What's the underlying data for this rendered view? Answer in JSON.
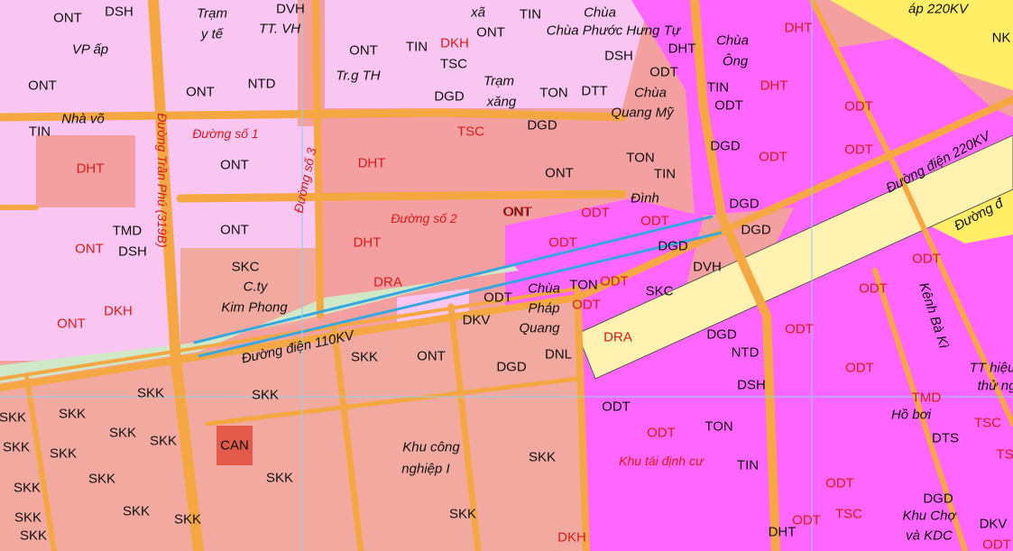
{
  "map": {
    "colors": {
      "land_residential_rural": "#f8c6f0",
      "land_public": "#f4a0a0",
      "land_industrial": "#f2aaa0",
      "land_urban": "#ff66ff",
      "road": "#f5a742",
      "power_corridor": "#fff2b0",
      "highlight_line": "#35a8e0",
      "label_red": "#d81a1a"
    },
    "road_names": {
      "tran_phu": "Đường Trần Phú (319B)",
      "duong_so_1": "Đường số 1",
      "duong_so_2": "Đường số 2",
      "duong_so_3": "Đường số 3",
      "duong_dien_110": "Đường điện 110KV",
      "duong_dien_220": "Đường điện 220KV",
      "duong_dien_220_top": "áp 220KV",
      "duong_right": "Đường đ",
      "kenh": "Kênh Bà Kì"
    },
    "places": {
      "vp_ap": "VP ấp",
      "tram_y_te_1": "Trạm",
      "tram_y_te_2": "y tế",
      "tt_vh": "TT. VH",
      "xa": "xã",
      "chua_phuoc_hung_tu": "Chùa Phước Hưng Tự",
      "chua_ong_1": "Chùa",
      "chua_ong_2": "Ông",
      "nha_vo": "Nhà võ",
      "tr_g_th": "Tr.g TH",
      "tram_xang_1": "Trạm",
      "tram_xang_2": "xăng",
      "chua_quang_my_1": "Chùa",
      "chua_quang_my_2": "Quang Mỹ",
      "dinh": "Đình",
      "ct_kim_phong_1": "C.ty",
      "ct_kim_phong_2": "Kim Phong",
      "chua_phap_quang_1": "Chùa",
      "chua_phap_quang_2": "Pháp",
      "chua_phap_quang_3": "Quang",
      "kcn_1": "Khu công",
      "kcn_2": "nghiệp I",
      "tt_hieu_1": "TT hiệu",
      "tt_hieu_2": "thử ng",
      "ho_boi": "Hồ bơi",
      "khu_tai_dinh_cu": "Khu tái định cư",
      "khu_cho_1": "Khu Chợ",
      "khu_cho_2": "và KDC"
    },
    "codes": [
      {
        "id": "c1",
        "text": "ONT",
        "red": false
      },
      {
        "id": "c2",
        "text": "DSH",
        "red": false
      },
      {
        "id": "c3",
        "text": "DVH",
        "red": false
      },
      {
        "id": "c4",
        "text": "TIN",
        "red": false
      },
      {
        "id": "c5",
        "text": "DHT",
        "red": true
      },
      {
        "id": "c6",
        "text": "ONT",
        "red": false
      },
      {
        "id": "c7",
        "text": "TIN",
        "red": false
      },
      {
        "id": "c8",
        "text": "DKH",
        "red": true
      },
      {
        "id": "c9",
        "text": "TSC",
        "red": false
      },
      {
        "id": "c10",
        "text": "ONT",
        "red": false
      },
      {
        "id": "c11",
        "text": "DHT",
        "red": false
      },
      {
        "id": "c12",
        "text": "ODT",
        "red": false
      },
      {
        "id": "c13",
        "text": "NK",
        "red": false
      },
      {
        "id": "c14",
        "text": "ONT",
        "red": false
      },
      {
        "id": "c15",
        "text": "ONT",
        "red": false
      },
      {
        "id": "c16",
        "text": "NTD",
        "red": false
      },
      {
        "id": "c17",
        "text": "DGD",
        "red": false
      },
      {
        "id": "c18",
        "text": "TON",
        "red": false
      },
      {
        "id": "c19",
        "text": "DTT",
        "red": false
      },
      {
        "id": "c20",
        "text": "DSH",
        "red": false
      },
      {
        "id": "c21",
        "text": "TIN",
        "red": false
      },
      {
        "id": "c22",
        "text": "ODT",
        "red": false
      },
      {
        "id": "c23",
        "text": "DHT",
        "red": true
      },
      {
        "id": "c24",
        "text": "ODT",
        "red": true
      },
      {
        "id": "c25",
        "text": "TIN",
        "red": false
      },
      {
        "id": "c26",
        "text": "TSC",
        "red": true
      },
      {
        "id": "c27",
        "text": "DGD",
        "red": false
      },
      {
        "id": "c28",
        "text": "DHT",
        "red": true
      },
      {
        "id": "c29",
        "text": "ONT",
        "red": false
      },
      {
        "id": "c30",
        "text": "DHT",
        "red": true
      },
      {
        "id": "c31",
        "text": "ONT",
        "red": false
      },
      {
        "id": "c32",
        "text": "TON",
        "red": false
      },
      {
        "id": "c33",
        "text": "TIN",
        "red": false
      },
      {
        "id": "c34",
        "text": "DGD",
        "red": false
      },
      {
        "id": "c35",
        "text": "ODT",
        "red": true
      },
      {
        "id": "c36",
        "text": "ODT",
        "red": true
      },
      {
        "id": "c37",
        "text": "DGD",
        "red": false
      },
      {
        "id": "c38",
        "text": "DGD",
        "red": false
      },
      {
        "id": "c39",
        "text": "ONT",
        "red": false
      },
      {
        "id": "c40",
        "text": "TMD",
        "red": false
      },
      {
        "id": "c41",
        "text": "DSH",
        "red": false
      },
      {
        "id": "c42",
        "text": "ONT",
        "red": true
      },
      {
        "id": "c43",
        "text": "ONT",
        "red": false
      },
      {
        "id": "c44",
        "text": "DHT",
        "red": true
      },
      {
        "id": "c45",
        "text": "ONT",
        "red": true
      },
      {
        "id": "c46",
        "text": "ODT",
        "red": true
      },
      {
        "id": "c47",
        "text": "ODT",
        "red": true
      },
      {
        "id": "c48",
        "text": "DGD",
        "red": false
      },
      {
        "id": "c49",
        "text": "ODT",
        "red": true
      },
      {
        "id": "c50",
        "text": "SKC",
        "red": false
      },
      {
        "id": "c51",
        "text": "DRA",
        "red": true
      },
      {
        "id": "c52",
        "text": "TON",
        "red": false
      },
      {
        "id": "c53",
        "text": "DVH",
        "red": false
      },
      {
        "id": "c54",
        "text": "SKC",
        "red": false
      },
      {
        "id": "c55",
        "text": "ODT",
        "red": true
      },
      {
        "id": "c56",
        "text": "ODT",
        "red": true
      },
      {
        "id": "c57",
        "text": "ODT",
        "red": false
      },
      {
        "id": "c58",
        "text": "ODT",
        "red": true
      },
      {
        "id": "c59",
        "text": "ONT",
        "red": true
      },
      {
        "id": "c60",
        "text": "DKH",
        "red": true
      },
      {
        "id": "c61",
        "text": "DKV",
        "red": false
      },
      {
        "id": "c62",
        "text": "DNL",
        "red": false
      },
      {
        "id": "c63",
        "text": "DRA",
        "red": true
      },
      {
        "id": "c64",
        "text": "DGD",
        "red": false
      },
      {
        "id": "c65",
        "text": "NTD",
        "red": false
      },
      {
        "id": "c66",
        "text": "ODT",
        "red": true
      },
      {
        "id": "c67",
        "text": "ODT",
        "red": true
      },
      {
        "id": "c68",
        "text": "SKK",
        "red": false
      },
      {
        "id": "c69",
        "text": "ONT",
        "red": false
      },
      {
        "id": "c70",
        "text": "DGD",
        "red": false
      },
      {
        "id": "c71",
        "text": "DSH",
        "red": false
      },
      {
        "id": "c72",
        "text": "ODT",
        "red": true
      },
      {
        "id": "c73",
        "text": "SKK",
        "red": false
      },
      {
        "id": "c74",
        "text": "SKK",
        "red": false
      },
      {
        "id": "c75",
        "text": "SKK",
        "red": false
      },
      {
        "id": "c76",
        "text": "ODT",
        "red": false
      },
      {
        "id": "c77",
        "text": "TMD",
        "red": true
      },
      {
        "id": "c78",
        "text": "SKK",
        "red": false
      },
      {
        "id": "c79",
        "text": "SKK",
        "red": false
      },
      {
        "id": "c80",
        "text": "SKK",
        "red": false
      },
      {
        "id": "c81",
        "text": "CAN",
        "red": false
      },
      {
        "id": "c82",
        "text": "TON",
        "red": false
      },
      {
        "id": "c83",
        "text": "ODT",
        "red": true
      },
      {
        "id": "c84",
        "text": "TSC",
        "red": true
      },
      {
        "id": "c85",
        "text": "DTS",
        "red": false
      },
      {
        "id": "c86",
        "text": "SKK",
        "red": false
      },
      {
        "id": "c87",
        "text": "SKK",
        "red": false
      },
      {
        "id": "c88",
        "text": "SKK",
        "red": false
      },
      {
        "id": "c89",
        "text": "SKK",
        "red": false
      },
      {
        "id": "c90",
        "text": "TIN",
        "red": false
      },
      {
        "id": "c91",
        "text": "TS",
        "red": true
      },
      {
        "id": "c92",
        "text": "SKK",
        "red": false
      },
      {
        "id": "c93",
        "text": "SKK",
        "red": false
      },
      {
        "id": "c94",
        "text": "ODT",
        "red": true
      },
      {
        "id": "c95",
        "text": "DGD",
        "red": false
      },
      {
        "id": "c96",
        "text": "SKK",
        "red": false
      },
      {
        "id": "c97",
        "text": "SKK",
        "red": false
      },
      {
        "id": "c98",
        "text": "SKK",
        "red": false
      },
      {
        "id": "c99",
        "text": "SKK",
        "red": false
      },
      {
        "id": "c100",
        "text": "DKH",
        "red": true
      },
      {
        "id": "c101",
        "text": "DHT",
        "red": false
      },
      {
        "id": "c102",
        "text": "ODT",
        "red": true
      },
      {
        "id": "c103",
        "text": "TSC",
        "red": true
      },
      {
        "id": "c104",
        "text": "DKV",
        "red": false
      },
      {
        "id": "c105",
        "text": "SKK",
        "red": false
      },
      {
        "id": "c106",
        "text": "ODT",
        "red": true
      }
    ]
  }
}
